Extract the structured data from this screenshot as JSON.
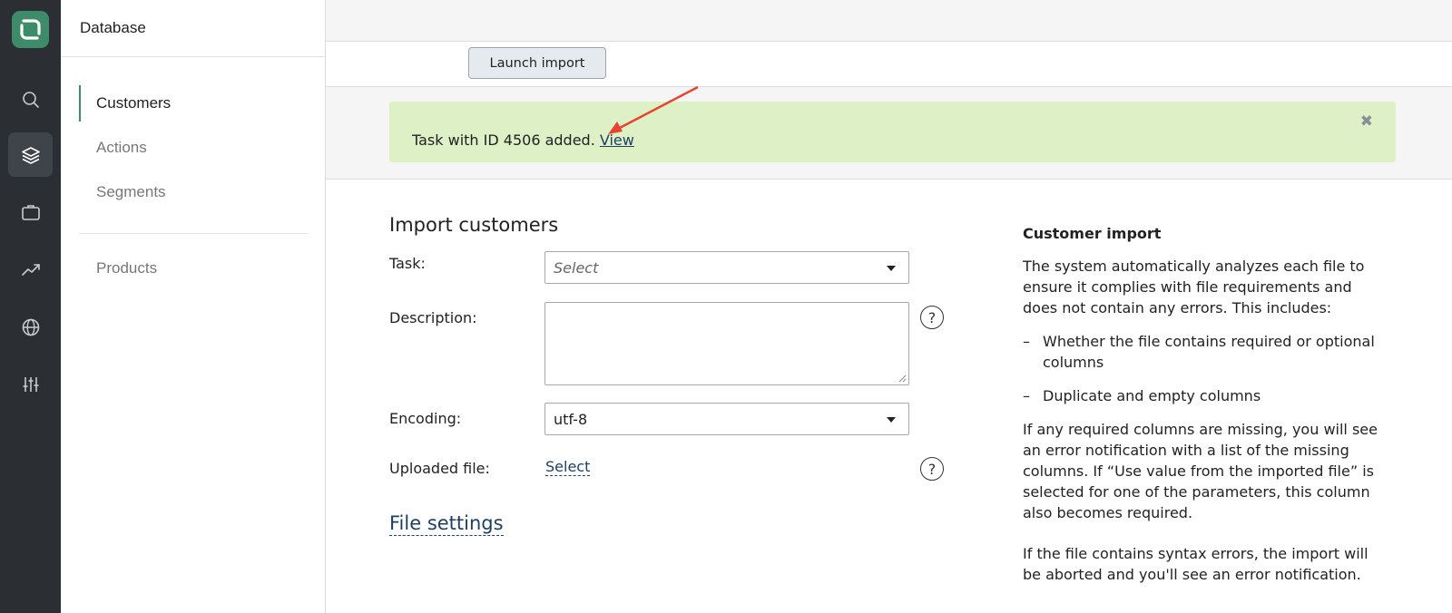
{
  "rail": {
    "items": [
      {
        "icon": "search-icon",
        "active": false
      },
      {
        "icon": "layers-icon",
        "active": true
      },
      {
        "icon": "briefcase-icon",
        "active": false
      },
      {
        "icon": "trending-up-icon",
        "active": false
      },
      {
        "icon": "globe-icon",
        "active": false
      },
      {
        "icon": "sliders-icon",
        "active": false
      }
    ]
  },
  "sidebar": {
    "title": "Database",
    "items": [
      {
        "label": "Customers",
        "active": true
      },
      {
        "label": "Actions",
        "active": false
      },
      {
        "label": "Segments",
        "active": false
      },
      {
        "label": "Products",
        "active": false
      }
    ]
  },
  "toolbar": {
    "launch_label": "Launch import"
  },
  "notice": {
    "text": "Task with ID 4506 added. ",
    "link": "View",
    "close": "✖"
  },
  "form": {
    "title": "Import customers",
    "task_label": "Task:",
    "task_placeholder": "Select",
    "description_label": "Description:",
    "encoding_label": "Encoding:",
    "encoding_value": "utf-8",
    "file_label": "Uploaded file:",
    "file_link": "Select",
    "help_glyph": "?",
    "settings_link": "File settings"
  },
  "info": {
    "title": "Customer import",
    "intro": "The system automatically analyzes each file to ensure it complies with file requirements and does not contain any errors. This includes:",
    "bullets": [
      "Whether the file contains required or optional columns",
      "Duplicate and empty columns"
    ],
    "bullet_mark": "–",
    "p2": "If any required columns are missing, you will see an error notification with a list of the missing columns. If “Use value from the imported file” is selected for one of the parameters, this column also becomes required.",
    "p3": "If the file contains syntax errors, the import will be aborted and you'll see an error notification."
  },
  "colors": {
    "rail_bg": "#2b2e33",
    "accent": "#3d8b68",
    "notice_bg": "#ddf0c6",
    "link": "#1f3f63",
    "annotation_arrow": "#e8432e"
  }
}
